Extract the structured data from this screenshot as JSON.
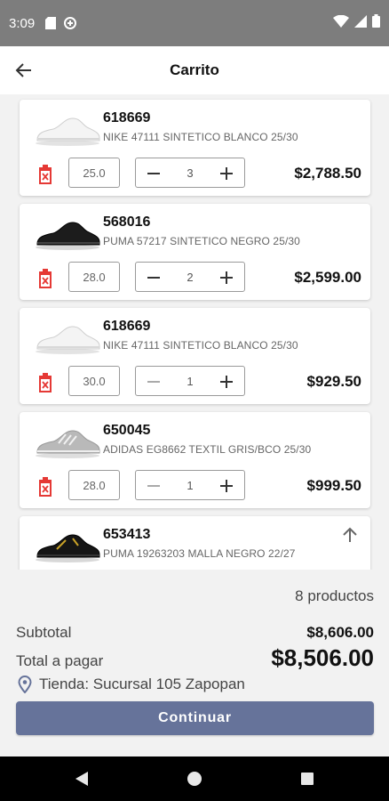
{
  "status_bar": {
    "time": "3:09"
  },
  "header": {
    "title": "Carrito"
  },
  "items": [
    {
      "code": "618669",
      "description": "NIKE 47111 SINTETICO BLANCO 25/30",
      "size": "25.0",
      "quantity": "3",
      "price": "$2,788.50",
      "shoe_color": "white"
    },
    {
      "code": "568016",
      "description": "PUMA 57217 SINTETICO NEGRO 25/30",
      "size": "28.0",
      "quantity": "2",
      "price": "$2,599.00",
      "shoe_color": "black"
    },
    {
      "code": "618669",
      "description": "NIKE 47111 SINTETICO BLANCO 25/30",
      "size": "30.0",
      "quantity": "1",
      "price": "$929.50",
      "shoe_color": "white"
    },
    {
      "code": "650045",
      "description": "ADIDAS EG8662 TEXTIL GRIS/BCO 25/30",
      "size": "28.0",
      "quantity": "1",
      "price": "$999.50",
      "shoe_color": "gray"
    },
    {
      "code": "653413",
      "description": "PUMA 19263203 MALLA NEGRO 22/27",
      "shoe_color": "black-gold"
    }
  ],
  "summary": {
    "count": "8 productos",
    "subtotal_label": "Subtotal",
    "subtotal_value": "$8,606.00",
    "total_label": "Total a pagar",
    "total_value": "$8,506.00",
    "store": "Tienda: Sucursal 105 Zapopan",
    "continue_label": "Continuar"
  },
  "colors": {
    "accent": "#66739a",
    "delete": "#e53935",
    "status_bar": "#7d7d7d"
  }
}
